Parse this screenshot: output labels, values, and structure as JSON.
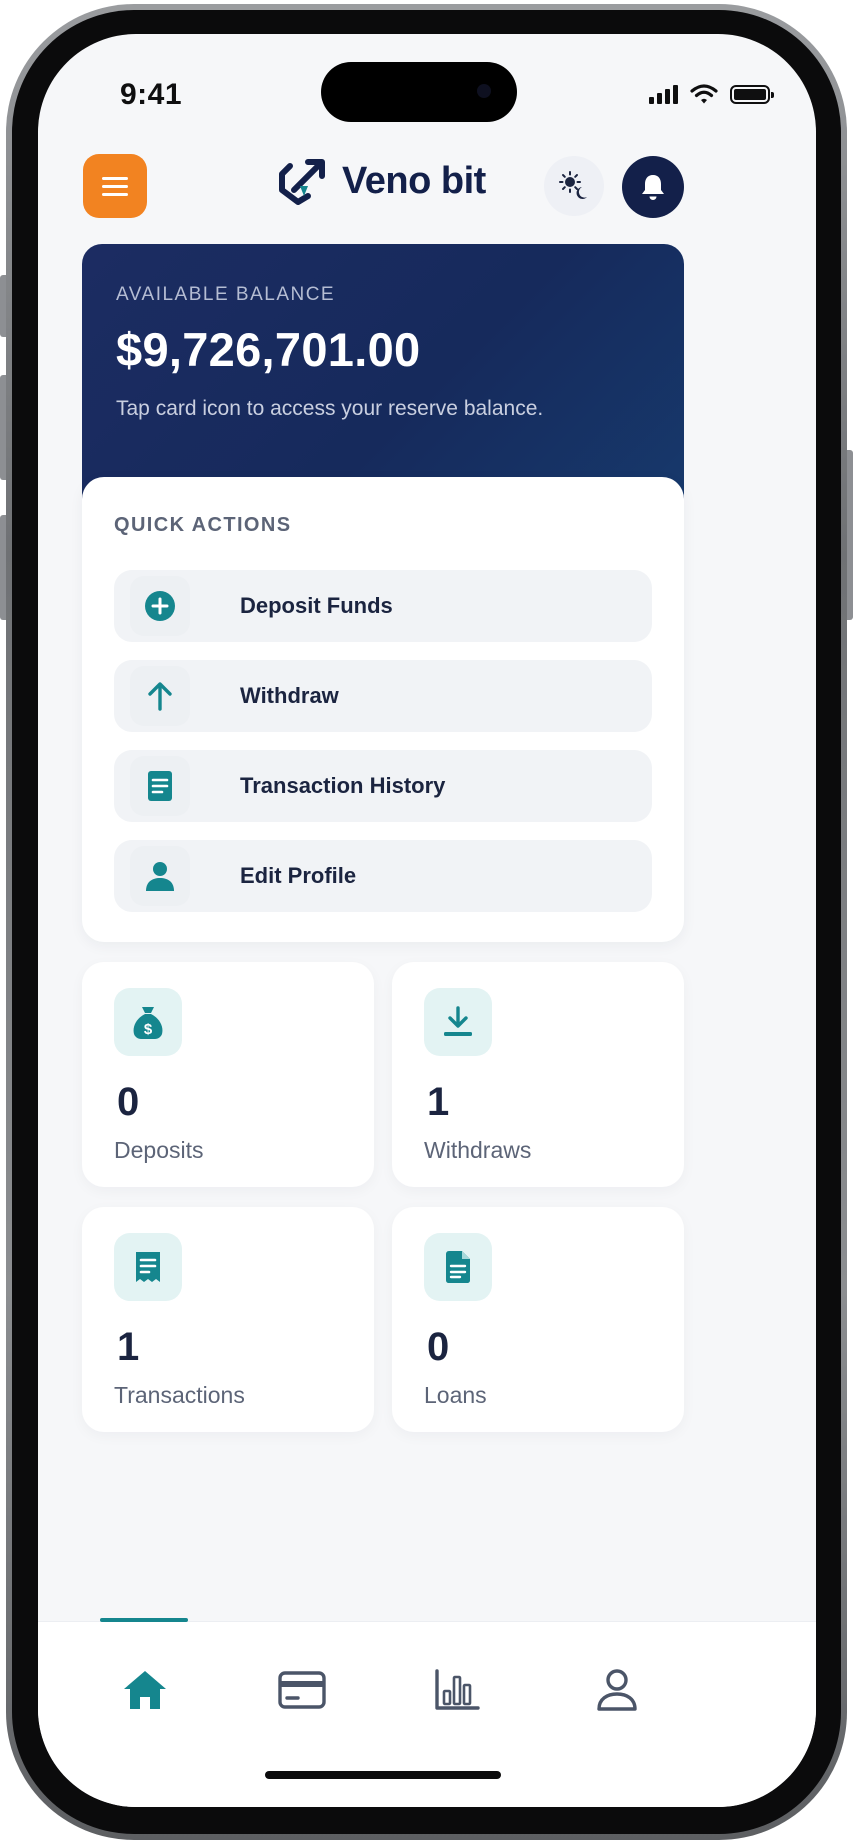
{
  "status_bar": {
    "time": "9:41"
  },
  "header": {
    "brand_name": "Veno bit",
    "menu_icon": "hamburger-icon",
    "theme_icon": "sun-moon-icon",
    "notification_icon": "bell-icon",
    "colors": {
      "menu": "#f28321",
      "brand": "#13204a"
    }
  },
  "balance": {
    "label": "AVAILABLE BALANCE",
    "amount": "$9,726,701.00",
    "hint": "Tap card icon to access your reserve balance."
  },
  "quick_actions": {
    "title": "QUICK ACTIONS",
    "items": [
      {
        "label": "Deposit Funds",
        "icon": "plus-circle-icon"
      },
      {
        "label": "Withdraw",
        "icon": "arrow-up-icon"
      },
      {
        "label": "Transaction History",
        "icon": "document-icon"
      },
      {
        "label": "Edit Profile",
        "icon": "user-icon"
      }
    ]
  },
  "stats": [
    {
      "value": "0",
      "label": "Deposits",
      "icon": "money-bag-icon"
    },
    {
      "value": "1",
      "label": "Withdraws",
      "icon": "download-icon"
    },
    {
      "value": "1",
      "label": "Transactions",
      "icon": "receipt-icon"
    },
    {
      "value": "0",
      "label": "Loans",
      "icon": "file-icon"
    }
  ],
  "bottom_nav": {
    "items": [
      {
        "name": "home",
        "icon": "home-icon",
        "active": true
      },
      {
        "name": "cards",
        "icon": "card-icon",
        "active": false
      },
      {
        "name": "analytics",
        "icon": "bar-chart-icon",
        "active": false
      },
      {
        "name": "profile",
        "icon": "user-outline-icon",
        "active": false
      }
    ]
  },
  "accent_color": "#15868e"
}
